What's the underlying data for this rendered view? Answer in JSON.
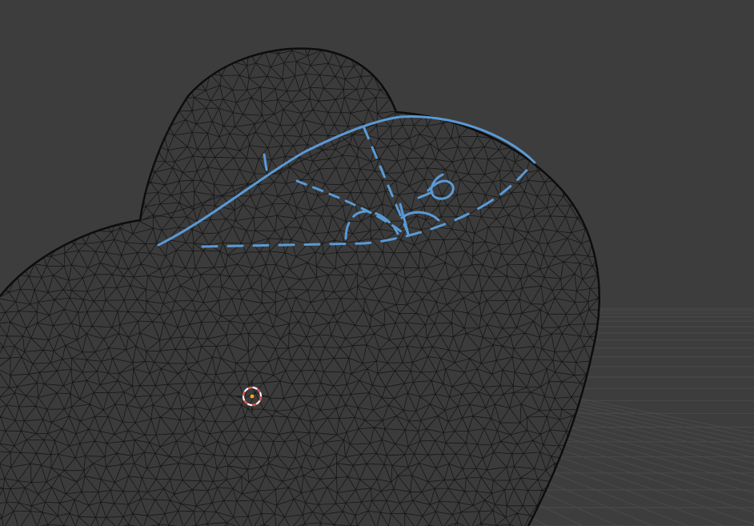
{
  "app": "3D Viewport",
  "colors": {
    "background": "#3d3d3d",
    "grid_line": "#4a4a4a",
    "mesh_fill": "#3b3b3b",
    "wireframe": "#111111",
    "annotation": "#5a9ad6",
    "cursor_red": "#e05050",
    "cursor_white": "#ffffff",
    "cursor_center": "#f5a623"
  },
  "objects": {
    "mesh_name": "sculpted-blob-mesh",
    "cursor_name": "3d-cursor",
    "annotation_name": "grease-pencil-annotation"
  }
}
